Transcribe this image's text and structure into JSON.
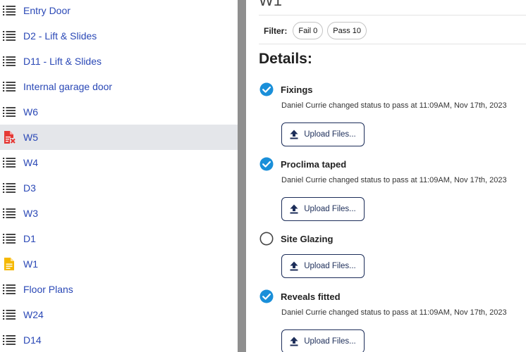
{
  "sidebar": {
    "items": [
      {
        "label": "Entry Door",
        "icon": "list-icon",
        "selected": false
      },
      {
        "label": "D2 - Lift & Slides",
        "icon": "list-icon",
        "selected": false
      },
      {
        "label": "D11 - Lift & Slides",
        "icon": "list-icon",
        "selected": false
      },
      {
        "label": "Internal garage door",
        "icon": "list-icon",
        "selected": false
      },
      {
        "label": "W6",
        "icon": "list-icon",
        "selected": false
      },
      {
        "label": "W5",
        "icon": "failed-document-icon",
        "selected": true
      },
      {
        "label": "W4",
        "icon": "list-icon",
        "selected": false
      },
      {
        "label": "D3",
        "icon": "list-icon",
        "selected": false
      },
      {
        "label": "W3",
        "icon": "list-icon",
        "selected": false
      },
      {
        "label": "D1",
        "icon": "list-icon",
        "selected": false
      },
      {
        "label": "W1",
        "icon": "document-icon",
        "selected": false
      },
      {
        "label": "Floor Plans",
        "icon": "list-icon",
        "selected": false
      },
      {
        "label": "W24",
        "icon": "list-icon",
        "selected": false
      },
      {
        "label": "D14",
        "icon": "list-icon",
        "selected": false
      }
    ]
  },
  "main": {
    "title": "W1",
    "filter": {
      "label": "Filter:",
      "chips": [
        {
          "label": "Fail 0"
        },
        {
          "label": "Pass 10"
        }
      ]
    },
    "details_title": "Details:",
    "upload_label": "Upload Files...",
    "items": [
      {
        "label": "Fixings",
        "checked": true,
        "status": "Daniel Currie changed status to pass at 11:09AM, Nov 17th, 2023"
      },
      {
        "label": "Proclima taped",
        "checked": true,
        "status": "Daniel Currie changed status to pass at 11:09AM, Nov 17th, 2023"
      },
      {
        "label": "Site Glazing",
        "checked": false,
        "status": ""
      },
      {
        "label": "Reveals fitted",
        "checked": true,
        "status": "Daniel Currie changed status to pass at 11:09AM, Nov 17th, 2023"
      }
    ]
  },
  "colors": {
    "link": "#2a48b6",
    "check": "#1a8fd9",
    "fail": "#e53935",
    "doc": "#f5b800",
    "selected_bg": "#e4e6ea",
    "button_border": "#1c2d59",
    "divider": "#8f8f8f"
  }
}
